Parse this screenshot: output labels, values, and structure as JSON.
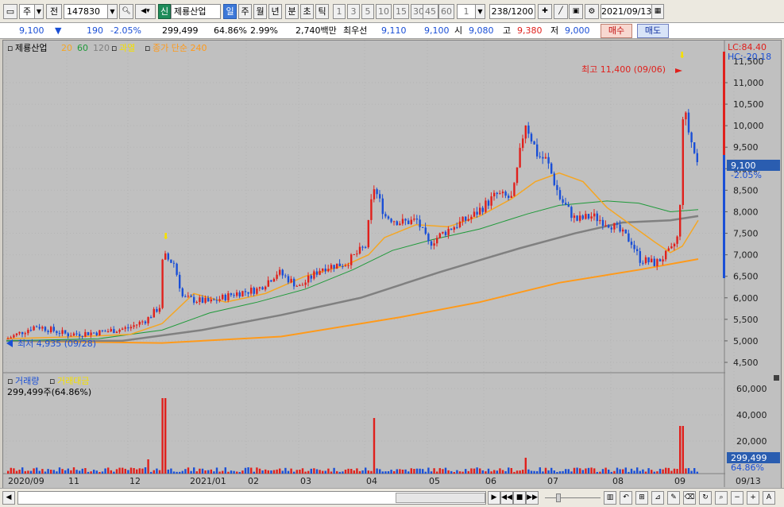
{
  "toolbar": {
    "market": "주",
    "prev": "전",
    "code": "147830",
    "badge": "신",
    "name": "제룡산업",
    "periods": [
      "일",
      "주",
      "월",
      "년",
      "분",
      "초",
      "틱"
    ],
    "minutes": [
      "1",
      "3",
      "5",
      "10",
      "15",
      "30",
      "45",
      "60"
    ],
    "minute_value": "1",
    "count": "238",
    "count_total": "/1200",
    "date": "2021/09/13"
  },
  "quote": {
    "price": "9,100",
    "arrow": "▼",
    "change": "190",
    "change_pct": "-2.05%",
    "volume": "299,499",
    "vol_ratio": "64.86%",
    "rate": "2.99%",
    "amount": "2,740백만",
    "best_label": "최우선",
    "best_ask": "9,110",
    "best_bid": "9,100",
    "open_label": "시",
    "open": "9,080",
    "high_label": "고",
    "high": "9,380",
    "low_label": "저",
    "low": "9,000",
    "buy_label": "매수",
    "sell_label": "매도"
  },
  "price_pane": {
    "legend": {
      "name": "제룡산업",
      "ma20": "20",
      "ma60": "60",
      "ma120": "120",
      "overheat": "과열",
      "closing_simple": "종가 단순 240"
    },
    "colors": {
      "up": "#e0201c",
      "down": "#1a4fd6",
      "ma20": "#f5a623",
      "ma60": "#1f9a3a",
      "ma120": "#808080",
      "ma240": "#ff9a1a",
      "bg": "#c0c0c0"
    },
    "lc": "LC:84.40",
    "hc": "HC:-20.18",
    "current_price": "9,100",
    "current_pct": "-2.05%",
    "high_note": "최고 11,400 (09/06)",
    "low_note": "최저 4,935 (09/28)",
    "y_ticks": [
      "11,000",
      "10,500",
      "10,000",
      "9,500",
      "9,000",
      "8,500",
      "8,000",
      "7,500",
      "7,000",
      "6,500",
      "6,000",
      "5,500",
      "5,000",
      "4,500"
    ],
    "y_top_partial": "11,500"
  },
  "volume_pane": {
    "legend_volume": "거래량",
    "legend_amount": "거래대금",
    "volume_text": "299,499주(64.86%)",
    "y_ticks": [
      "60,000",
      "40,000",
      "20,000"
    ],
    "current_volume": "299,499",
    "current_pct": "64.86%"
  },
  "x_axis": {
    "labels": [
      "2020/09",
      "11",
      "12",
      "2021/01",
      "02",
      "03",
      "04",
      "05",
      "06",
      "07",
      "08",
      "09",
      "09/13"
    ]
  }
}
